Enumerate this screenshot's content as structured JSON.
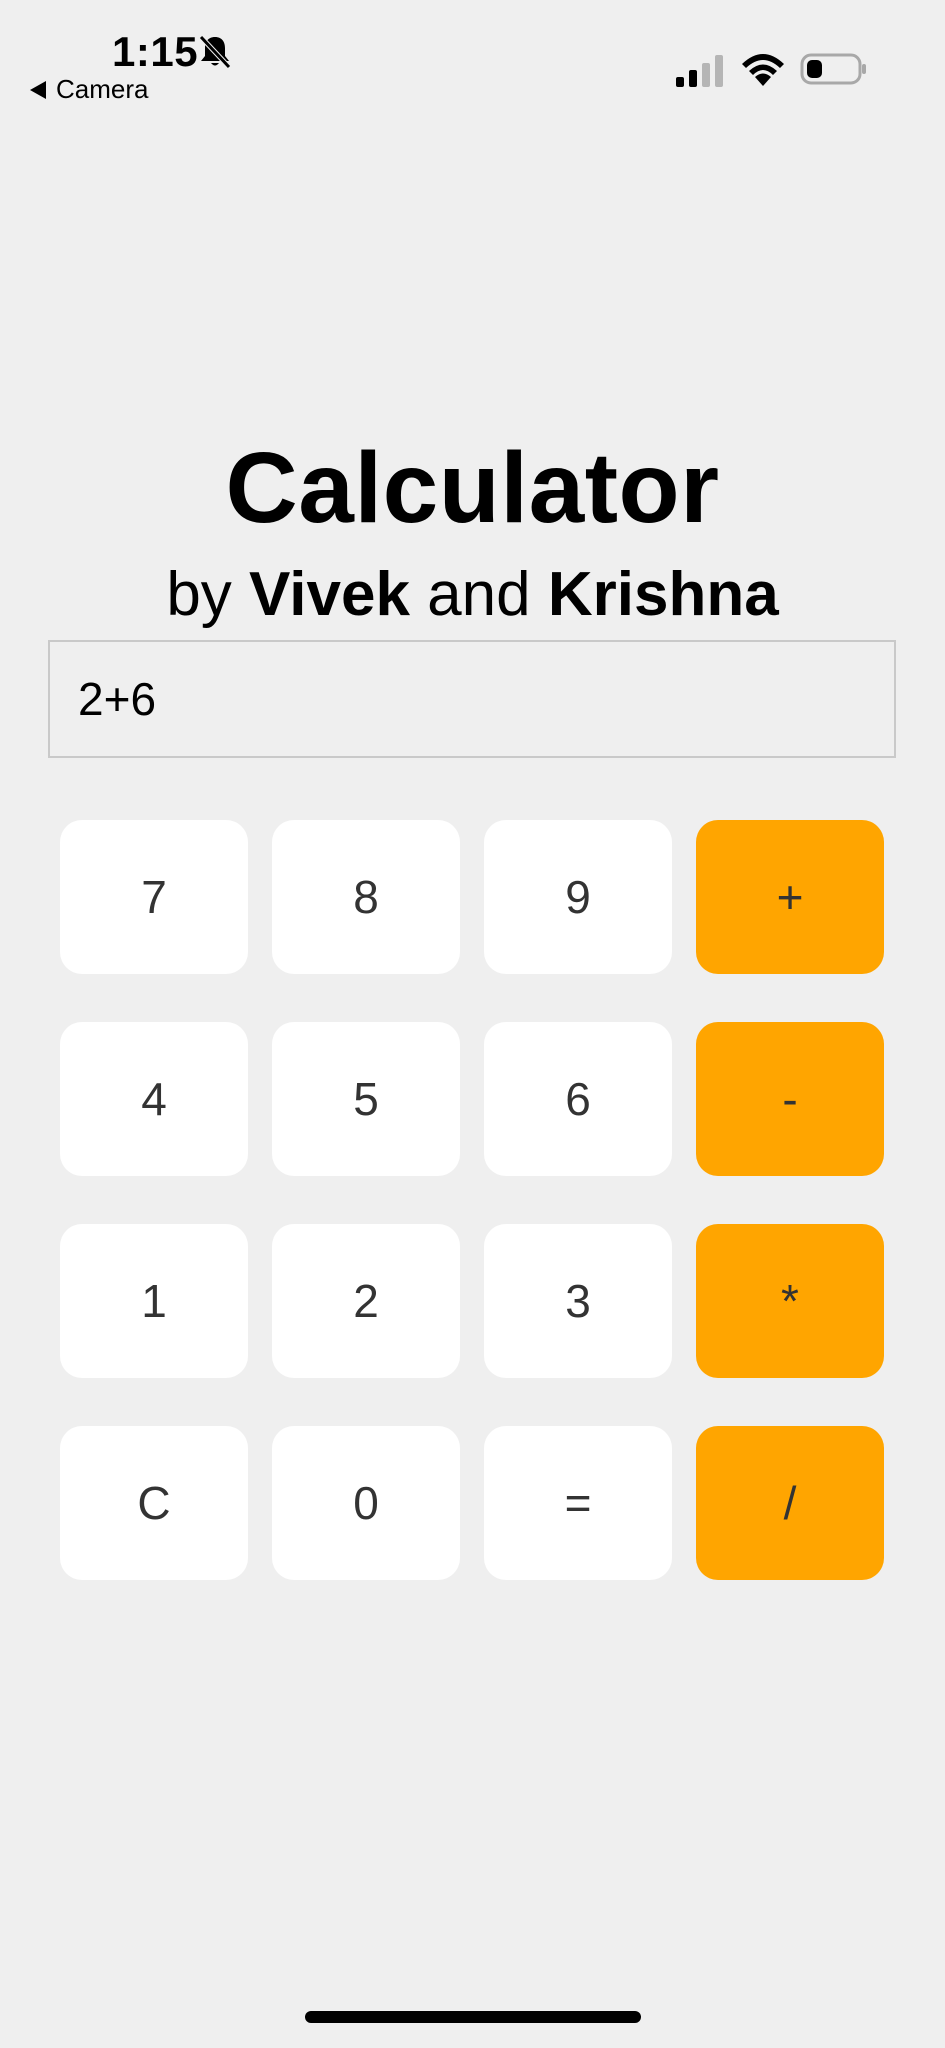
{
  "status_bar": {
    "time": "1:15",
    "back_label": "Camera",
    "icons": [
      "bell-slash-icon",
      "cellular-signal-icon",
      "wifi-icon",
      "battery-icon"
    ]
  },
  "header": {
    "title": "Calculator",
    "subtitle_prefix": "by ",
    "author1": "Vivek",
    "subtitle_mid": " and ",
    "author2": "Krishna"
  },
  "display": {
    "value": "2+6"
  },
  "keys": [
    {
      "label": "7",
      "type": "digit"
    },
    {
      "label": "8",
      "type": "digit"
    },
    {
      "label": "9",
      "type": "digit"
    },
    {
      "label": "+",
      "type": "operator"
    },
    {
      "label": "4",
      "type": "digit"
    },
    {
      "label": "5",
      "type": "digit"
    },
    {
      "label": "6",
      "type": "digit"
    },
    {
      "label": "-",
      "type": "operator"
    },
    {
      "label": "1",
      "type": "digit"
    },
    {
      "label": "2",
      "type": "digit"
    },
    {
      "label": "3",
      "type": "digit"
    },
    {
      "label": "*",
      "type": "operator"
    },
    {
      "label": "C",
      "type": "clear"
    },
    {
      "label": "0",
      "type": "digit"
    },
    {
      "label": "=",
      "type": "equals"
    },
    {
      "label": "/",
      "type": "operator"
    }
  ],
  "colors": {
    "background": "#efefef",
    "key": "#ffffff",
    "operator_key": "#ffa500",
    "key_text": "#333333"
  }
}
